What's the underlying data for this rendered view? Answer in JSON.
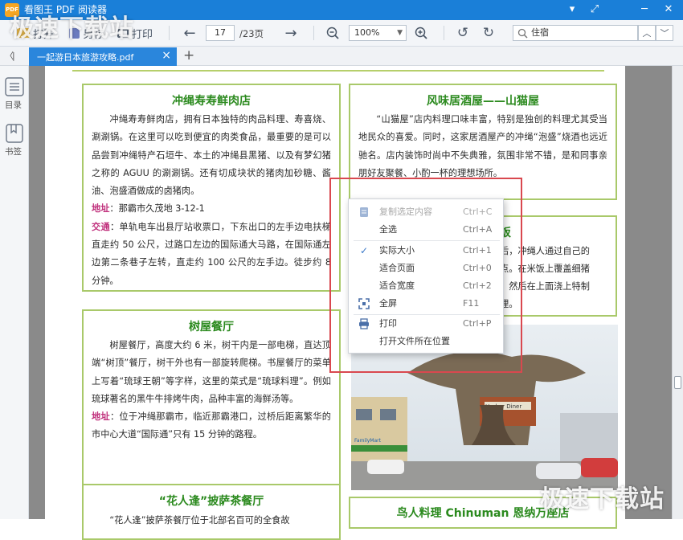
{
  "app": {
    "title": "看图王 PDF 阅读器",
    "logo_text": "PDF"
  },
  "window_controls": [
    "▾",
    "⤢",
    "─",
    "✕"
  ],
  "watermark": {
    "top": "极速下载站",
    "bottom": "极速下载站"
  },
  "toolbar": {
    "open_label": "打开",
    "save_label": "另存",
    "print_label": "打印",
    "page_current": "17",
    "page_total": "/23页",
    "zoom": "100%",
    "search_value": "住宿"
  },
  "tab": {
    "label": "一起游日本旅游攻略.pdf",
    "close": "×",
    "new": "+"
  },
  "sidebar": {
    "toc_label": "目录",
    "bookmark_label": "书签",
    "collapse": "〈|"
  },
  "cards": {
    "c1": {
      "title": "冲绳寿寿鲜肉店",
      "body": "冲绳寿寿鲜肉店，拥有日本独特的肉品料理、寿喜烧、涮涮锅。在这里可以吃到便宜的肉类食品，最重要的是可以品尝到冲绳特产石垣牛、本土的冲绳县黑猪、以及有梦幻猪之称的 AGUU 的涮涮锅。还有切成块状的猪肉加砂糖、酱油、泡盛酒做成的卤猪肉。",
      "addr_label": "地址",
      "addr": "：那霸市久茂地 3-12-1",
      "traffic_label": "交通",
      "traffic": "：单轨电车出县厅站收票口，下东出口的左手边电扶梯直走约 50 公尺，过路口左边的国际通大马路，在国际通左边第二条巷子左转，直走约 100 公尺的左手边。徒步约 8 分钟。"
    },
    "c2": {
      "title": "树屋餐厅",
      "body": "树屋餐厅，高度大约 6 米，树干内是一部电梯，直达顶端“树顶”餐厅，树干外也有一部旋转爬梯。书屋餐厅的菜单上写着“琉球王朝”等字样，这里的菜式是“琉球料理”。例如琉球著名的黑牛牛排烤牛肉，品种丰富的海鲜汤等。",
      "addr_label": "地址",
      "addr": "：位于冲绳那霸市，临近那霸港口，过桥后距离繁华的市中心大道“国际通”只有 15 分钟的路程。"
    },
    "c3": {
      "title": "“花人逢”披萨茶餐厅",
      "partial": "“花人逢”披萨茶餐厅位于北部名百可的全食故"
    },
    "c4": {
      "title": "风味居酒屋——山猫屋",
      "body": "“山猫屋”店内料理口味丰富，特别是独创的料理尤其受当地民众的喜爱。同时，这家居酒屋产的冲绳“泡盛”烧酒也远近驰名。店内装饰时尚中不失典雅，氛围非常不错，是和同事亲朋好友聚餐、小酌一杯的理想场所。"
    },
    "c5": {
      "title_tail": "饭",
      "lines": [
        "后，冲绳人通过自己的",
        "点。在米饭上覆盖细猪",
        "，然后在上面浇上特制",
        "理。"
      ]
    },
    "c6": {
      "title": "鸟人料理 Chinuman 恩纳万座店"
    },
    "photo": {
      "sign": "Harbor Diner",
      "shop": "FamilyMart"
    }
  },
  "context_menu": {
    "items": [
      {
        "label": "复制选定内容",
        "shortcut": "Ctrl+C",
        "icon": "copy-icon",
        "disabled": true
      },
      {
        "label": "全选",
        "shortcut": "Ctrl+A",
        "icon": "",
        "disabled": false
      },
      {
        "label": "实际大小",
        "shortcut": "Ctrl+1",
        "icon": "check-icon",
        "disabled": false
      },
      {
        "label": "适合页面",
        "shortcut": "Ctrl+0",
        "icon": "",
        "disabled": false
      },
      {
        "label": "适合宽度",
        "shortcut": "Ctrl+2",
        "icon": "",
        "disabled": false
      },
      {
        "label": "全屏",
        "shortcut": "F11",
        "icon": "fullscreen-icon",
        "disabled": false
      },
      {
        "label": "打印",
        "shortcut": "Ctrl+P",
        "icon": "printer-icon",
        "disabled": false
      },
      {
        "label": "打开文件所在位置",
        "shortcut": "",
        "icon": "",
        "disabled": false
      }
    ]
  },
  "colors": {
    "title_bar": "#1a7fd8",
    "card_border": "#a9c96a",
    "card_title": "#2b8a1e",
    "label": "#c0307c",
    "highlight_box": "#d9484f"
  }
}
